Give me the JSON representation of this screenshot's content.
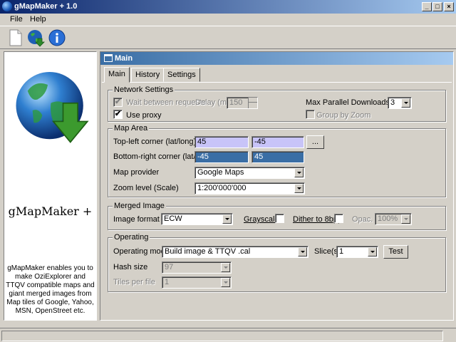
{
  "window": {
    "title": "gMapMaker + 1.0"
  },
  "menu": {
    "items": [
      "File",
      "Help"
    ]
  },
  "toolbar": {
    "buttons": [
      "new-document-icon",
      "globe-download-icon",
      "info-icon"
    ]
  },
  "colors": {
    "title_bar": "#0a246a",
    "panel_header": "#3a6ea5",
    "lavender_field": "#c8c4f8",
    "selected_field": "#3a6ea5"
  },
  "left_panel": {
    "logo_text": "gMapMaker +",
    "description": "gMapMaker enables you to make OziExplorer and TTQV compatible maps and giant merged images from Map tiles of Google, Yahoo, MSN, OpenStreet etc."
  },
  "panel": {
    "title": "Main",
    "tabs": [
      "Main",
      "History",
      "Settings"
    ],
    "active_tab": "Main"
  },
  "network": {
    "title": "Network Settings",
    "wait_label": "Wait between requests",
    "wait_checked": "✔",
    "delay_label": "Delay (ms)",
    "delay_value": "150",
    "use_proxy_label": "Use proxy",
    "use_proxy_checked": "✔",
    "max_parallel_label": "Max Parallel Downloads",
    "max_parallel_value": "3",
    "group_by_zoom_label": "Group by Zoom"
  },
  "map_area": {
    "title": "Map Area",
    "top_left_label": "Top-left corner (lat/long)",
    "top_left_lat": "45",
    "top_left_long": "-45",
    "browse_label": "...",
    "bottom_right_label": "Bottom-right corner (lat/long)",
    "bottom_right_lat": "-45",
    "bottom_right_long": "45",
    "provider_label": "Map provider",
    "provider_value": "Google Maps",
    "zoom_label": "Zoom level (Scale)",
    "zoom_value": "1:200'000'000"
  },
  "merged_image": {
    "title": "Merged Image",
    "format_label": "Image format",
    "format_value": "ECW",
    "grayscale_label": "Grayscale",
    "dither_label": "Dither to 8bpp",
    "opac_label": "Opac.",
    "opac_value": "100%"
  },
  "operating": {
    "title": "Operating",
    "mode_label": "Operating mode",
    "mode_value": "Build image & TTQV .cal",
    "slices_label": "Slice(s)",
    "slices_value": "1",
    "test_label": "Test",
    "hash_label": "Hash size",
    "hash_value": "97",
    "tiles_label": "Tiles per file",
    "tiles_value": "1"
  }
}
